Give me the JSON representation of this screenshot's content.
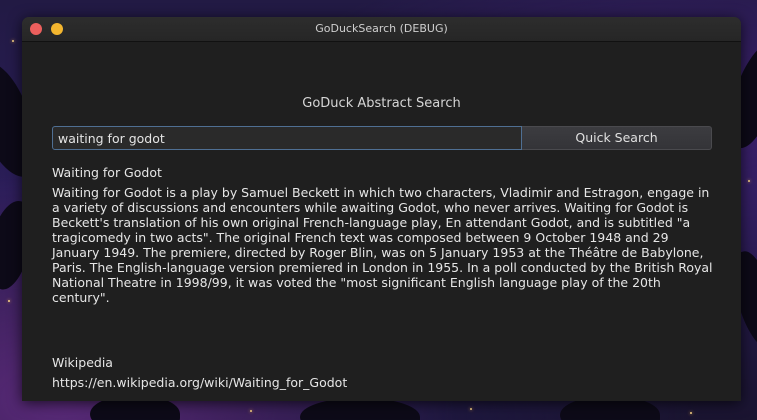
{
  "window": {
    "title": "GoDuckSearch (DEBUG)"
  },
  "app": {
    "heading": "GoDuck Abstract Search"
  },
  "search": {
    "query": "waiting for godot",
    "button_label": "Quick Search"
  },
  "result": {
    "title": "Waiting for Godot",
    "abstract": "Waiting for Godot is a play by Samuel Beckett in which two characters, Vladimir and Estragon, engage in a variety of discussions and encounters while awaiting Godot, who never arrives. Waiting for Godot is Beckett's translation of his own original French-language play, En attendant Godot, and is subtitled \"a tragicomedy in two acts\". The original French text was composed between 9 October 1948 and 29 January 1949. The premiere, directed by Roger Blin, was on 5 January 1953 at the Théâtre de Babylone, Paris. The English-language version premiered in London in 1955. In a poll conducted by the British Royal National Theatre in 1998/99, it was voted the \"most significant English language play of the 20th century\".",
    "source": "Wikipedia",
    "url": "https://en.wikipedia.org/wiki/Waiting_for_Godot"
  },
  "colors": {
    "window_bg": "#1f1f1f",
    "titlebar_bg": "#2d2d2d",
    "close_button": "#ec5f5d",
    "minimize_button": "#f3b62f",
    "input_focus_border": "#4f6f93",
    "text": "#e6e6e6"
  }
}
